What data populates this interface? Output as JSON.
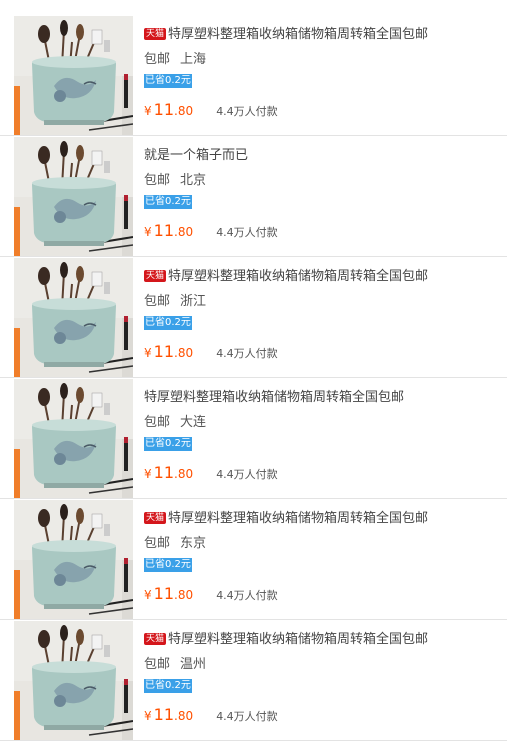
{
  "items": [
    {
      "tag": "天猫",
      "title": "特厚塑料整理箱收纳箱储物箱周转箱全国包邮",
      "shipping": "包邮",
      "city": "上海",
      "saved": "已省0.2元",
      "currency": "¥",
      "price_int": "11",
      "price_dec": ".80",
      "paid": "4.4万人付款"
    },
    {
      "tag": "",
      "title": "就是一个箱子而已",
      "shipping": "包邮",
      "city": "北京",
      "saved": "已省0.2元",
      "currency": "¥",
      "price_int": "11",
      "price_dec": ".80",
      "paid": "4.4万人付款"
    },
    {
      "tag": "天猫",
      "title": "特厚塑料整理箱收纳箱储物箱周转箱全国包邮",
      "shipping": "包邮",
      "city": "浙江",
      "saved": "已省0.2元",
      "currency": "¥",
      "price_int": "11",
      "price_dec": ".80",
      "paid": "4.4万人付款"
    },
    {
      "tag": "",
      "title": "特厚塑料整理箱收纳箱储物箱周转箱全国包邮",
      "shipping": "包邮",
      "city": "大连",
      "saved": "已省0.2元",
      "currency": "¥",
      "price_int": "11",
      "price_dec": ".80",
      "paid": "4.4万人付款"
    },
    {
      "tag": "天猫",
      "title": "特厚塑料整理箱收纳箱储物箱周转箱全国包邮",
      "shipping": "包邮",
      "city": "东京",
      "saved": "已省0.2元",
      "currency": "¥",
      "price_int": "11",
      "price_dec": ".80",
      "paid": "4.4万人付款"
    },
    {
      "tag": "天猫",
      "title": "特厚塑料整理箱收纳箱储物箱周转箱全国包邮",
      "shipping": "包邮",
      "city": "温州",
      "saved": "已省0.2元",
      "currency": "¥",
      "price_int": "11",
      "price_dec": ".80",
      "paid": "4.4万人付款"
    }
  ],
  "colors": {
    "price": "#ff5000",
    "tmall_tag": "#d4161b",
    "saved_badge": "#3aa0e8"
  }
}
